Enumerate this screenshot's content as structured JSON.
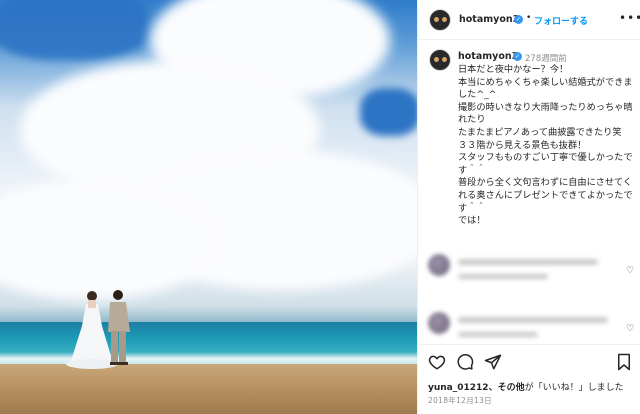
{
  "post": {
    "username": "hotamyon3",
    "follow_label": "フォローする",
    "time_ago": "278週間前",
    "caption": "日本だと夜中かなー？今！\n本当にめちゃくちゃ楽しい結婚式ができました^_^\n撮影の時いきなり大雨降ったりめっちゃ晴れたり\nたまたまピアノあって曲披露できたり笑\n３３階から見える景色も抜群！\nスタッフもものすごい丁寧で優しかったです＾＾\n普段から全く文句言わずに自由にさせてくれる奥さんにプレゼントできてよかったです＾＾\nでは！",
    "likes_user": "yuna_01212",
    "likes_text": "、その他",
    "likes_quote": "「いいね！」",
    "likes_suffix": "しました",
    "date": "2018年12月13日"
  },
  "icons": {
    "verified": "verified-badge-icon",
    "more": "more-options-icon",
    "heart": "heart-icon",
    "comment": "comment-icon",
    "share": "share-icon",
    "bookmark": "bookmark-icon"
  },
  "colors": {
    "follow": "#0095f6",
    "verified": "#3897f0",
    "muted": "#8e8e8e"
  }
}
